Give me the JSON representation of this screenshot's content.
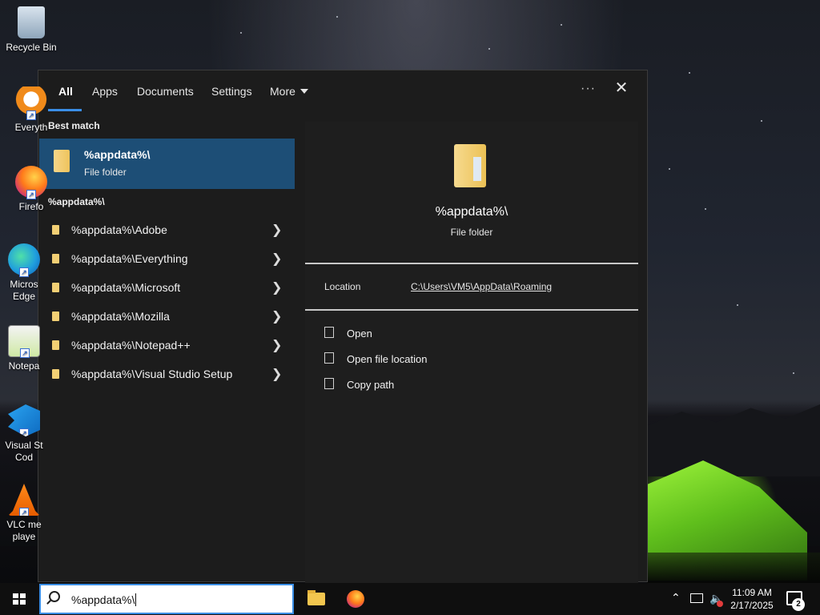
{
  "desktop": {
    "icons": [
      {
        "label": "Recycle Bin",
        "icon": "recycle-bin-icon"
      },
      {
        "label": "Everyth",
        "icon": "everything-icon"
      },
      {
        "label": "Firefo",
        "icon": "firefox-icon"
      },
      {
        "label": "Micros Edge",
        "icon": "edge-icon"
      },
      {
        "label": "Notepa",
        "icon": "notepad-plus-plus-icon"
      },
      {
        "label": "Visual St Cod",
        "icon": "vscode-icon"
      },
      {
        "label": "VLC me playe",
        "icon": "vlc-icon"
      }
    ]
  },
  "search": {
    "tabs": [
      {
        "label": "All"
      },
      {
        "label": "Apps"
      },
      {
        "label": "Documents"
      },
      {
        "label": "Settings"
      },
      {
        "label": "More"
      }
    ],
    "more_options_icon": "ellipsis-icon",
    "close_icon": "close-icon",
    "best_match_heading": "Best match",
    "best_match": {
      "title": "%appdata%\\",
      "subtitle": "File folder"
    },
    "group_heading": "%appdata%\\",
    "results": [
      {
        "label": "%appdata%\\Adobe"
      },
      {
        "label": "%appdata%\\Everything"
      },
      {
        "label": "%appdata%\\Microsoft"
      },
      {
        "label": "%appdata%\\Mozilla"
      },
      {
        "label": "%appdata%\\Notepad++"
      },
      {
        "label": "%appdata%\\Visual Studio Setup"
      }
    ],
    "preview": {
      "title": "%appdata%\\",
      "subtitle": "File folder",
      "location_label": "Location",
      "location_value": "C:\\Users\\VM5\\AppData\\Roaming",
      "actions": [
        {
          "label": "Open",
          "icon": "open-icon"
        },
        {
          "label": "Open file location",
          "icon": "file-location-icon"
        },
        {
          "label": "Copy path",
          "icon": "copy-icon"
        }
      ]
    },
    "query": "%appdata%\\"
  },
  "taskbar": {
    "time": "11:09 AM",
    "date": "2/17/2025",
    "notification_count": "2",
    "pinned": [
      {
        "name": "File Explorer",
        "icon": "file-explorer-icon"
      },
      {
        "name": "Firefox",
        "icon": "firefox-icon"
      }
    ]
  },
  "colors": {
    "accent": "#3a8ee6",
    "selected_row": "#1d4e76",
    "panel_bg": "#1c1c1c"
  }
}
